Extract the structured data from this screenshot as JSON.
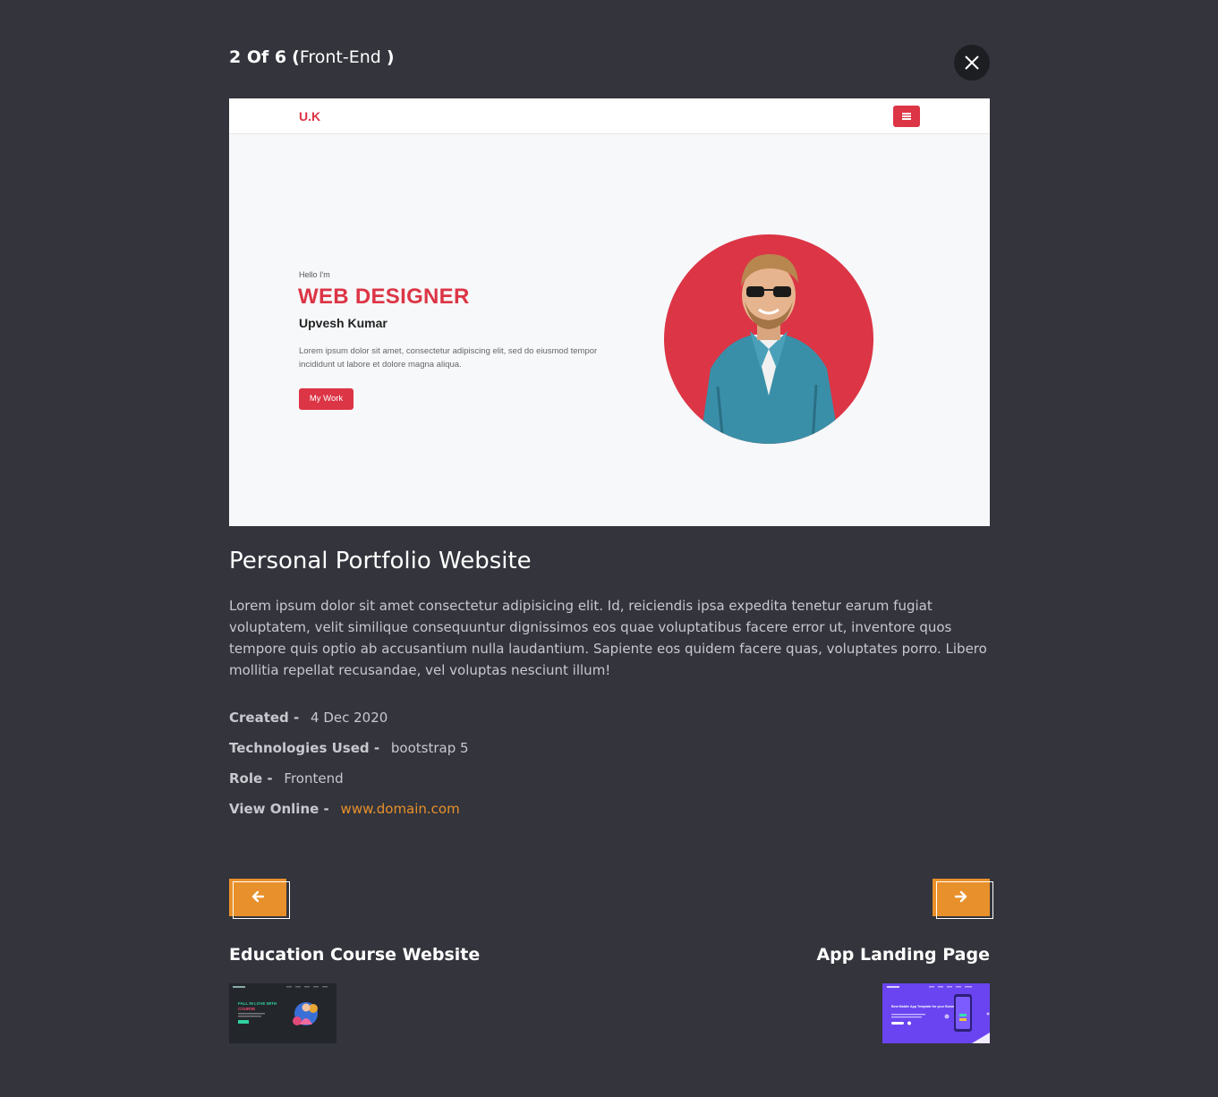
{
  "header": {
    "position": "2 Of 6",
    "open_paren": "(",
    "category": "Front-End",
    "close_paren": ")"
  },
  "preview": {
    "logo": "U.K",
    "greeting": "Hello I'm",
    "role": "WEB DESIGNER",
    "name": "Upvesh Kumar",
    "description": "Lorem ipsum dolor sit amet, consectetur adipiscing elit, sed do eiusmod tempor incididunt ut labore et dolore magna aliqua.",
    "button": "My Work",
    "accent_color": "#dc3545"
  },
  "project": {
    "title": "Personal Portfolio Website",
    "description": "Lorem ipsum dolor sit amet consectetur adipisicing elit. Id, reiciendis ipsa expedita tenetur earum fugiat voluptatem, velit similique consequuntur dignissimos eos quae voluptatibus facere error ut, inventore quos tempore quis optio ab accusantium nulla laudantium. Sapiente eos quidem facere quas, voluptates porro. Libero mollitia repellat recusandae, vel voluptas nesciunt illum!",
    "meta": {
      "created_label": "Created -",
      "created_value": "4 Dec 2020",
      "tech_label": "Technologies Used -",
      "tech_value": "bootstrap 5",
      "role_label": "Role -",
      "role_value": "Frontend",
      "online_label": "View Online -",
      "online_value": "www.domain.com"
    }
  },
  "navigation": {
    "prev_icon": "arrow-left-icon",
    "next_icon": "arrow-right-icon",
    "prev_title": "Education Course Website",
    "next_title": "App Landing Page"
  },
  "thumbnails": {
    "prev": {
      "heading": "FALL IN LOVE WITH",
      "heading_accent": "COURSE"
    },
    "next": {
      "heading": "Best Mobile App Template for your Business"
    }
  },
  "colors": {
    "background": "#33343c",
    "accent": "#e8902b",
    "close_button": "#1d1e22"
  }
}
